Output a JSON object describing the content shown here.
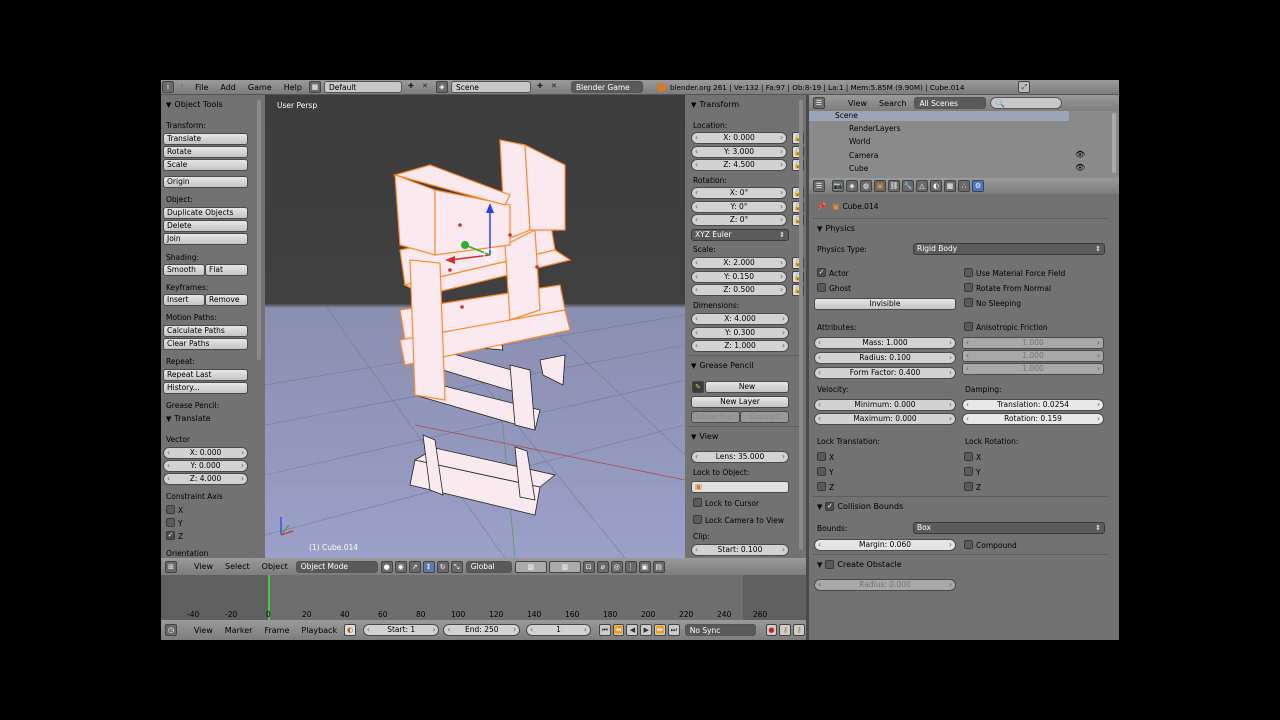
{
  "topbar": {
    "menus": [
      "File",
      "Add",
      "Game",
      "Help"
    ],
    "layout": "Default",
    "scene": "Scene",
    "engine": "Blender Game",
    "stats": "blender.org 261 | Ve:132 | Fa:97 | Ob:8-19 | La:1 | Mem:5.85M (9.90M) | Cube.014"
  },
  "toolshelf": {
    "title": "Object Tools",
    "transform_label": "Transform:",
    "translate": "Translate",
    "rotate": "Rotate",
    "scale": "Scale",
    "origin": "Origin",
    "object_label": "Object:",
    "duplicate": "Duplicate Objects",
    "delete": "Delete",
    "join": "Join",
    "shading_label": "Shading:",
    "smooth": "Smooth",
    "flat": "Flat",
    "keyframes_label": "Keyframes:",
    "insert": "Insert",
    "remove": "Remove",
    "motion_label": "Motion Paths:",
    "calc_paths": "Calculate Paths",
    "clear_paths": "Clear Paths",
    "repeat_label": "Repeat:",
    "repeat_last": "Repeat Last",
    "history": "History...",
    "grease_label": "Grease Pencil:",
    "op_title": "Translate",
    "vector_label": "Vector",
    "vx": "X: 0.000",
    "vy": "Y: 0.000",
    "vz": "Z: 4.000",
    "constraint_label": "Constraint Axis",
    "cx": "X",
    "cy": "Y",
    "cz": "Z",
    "orientation_label": "Orientation"
  },
  "viewport": {
    "title": "User Persp",
    "object": "(1) Cube.014",
    "mode": "Object Mode",
    "orientation": "Global",
    "menus": [
      "View",
      "Select",
      "Object"
    ]
  },
  "npanel": {
    "transform_title": "Transform",
    "location_label": "Location:",
    "lx": "X: 0.000",
    "ly": "Y: 3.000",
    "lz": "Z: 4.500",
    "rotation_label": "Rotation:",
    "rx": "X: 0°",
    "ry": "Y: 0°",
    "rz": "Z: 0°",
    "euler": "XYZ Euler",
    "scale_label": "Scale:",
    "sx": "X: 2.000",
    "sy": "Y: 0.150",
    "sz": "Z: 0.500",
    "dimensions_label": "Dimensions:",
    "dx": "X: 4.000",
    "dy": "Y: 0.300",
    "dz": "Z: 1.000",
    "grease_title": "Grease Pencil",
    "new": "New",
    "new_layer": "New Layer",
    "delete_frame": "Delete Frame",
    "convert": "Convert",
    "view_title": "View",
    "lens": "Lens: 35.000",
    "lock_object": "Lock to Object:",
    "lock_cursor": "Lock to Cursor",
    "lock_camera": "Lock Camera to View",
    "clip_label": "Clip:",
    "clip_start": "Start: 0.100"
  },
  "timeline": {
    "ticks": [
      "-40",
      "-20",
      "0",
      "20",
      "40",
      "60",
      "80",
      "100",
      "120",
      "140",
      "160",
      "180",
      "200",
      "220",
      "240",
      "260"
    ],
    "menus": [
      "View",
      "Marker",
      "Frame",
      "Playback"
    ],
    "start": "Start: 1",
    "end": "End: 250",
    "current": "1",
    "sync": "No Sync"
  },
  "outliner": {
    "menus": [
      "View",
      "Search"
    ],
    "filter": "All Scenes",
    "items": [
      "Scene",
      "RenderLayers",
      "World",
      "Camera",
      "Cube"
    ]
  },
  "props": {
    "breadcrumb": "Cube.014",
    "physics_title": "Physics",
    "physics_type_label": "Physics Type:",
    "physics_type": "Rigid Body",
    "actor": "Actor",
    "ghost": "Ghost",
    "invisible": "Invisible",
    "use_material_friction": "Use Material Force Field",
    "rotate_from_normal": "Rotate From Normal",
    "no_sleeping": "No Sleeping",
    "attributes_label": "Attributes:",
    "mass": "Mass: 1.000",
    "radius": "Radius: 0.100",
    "form_factor": "Form Factor: 0.400",
    "anisotropic": "Anisotropic Friction",
    "aniso_vals": [
      "1.000",
      "1.000",
      "1.000"
    ],
    "velocity_label": "Velocity:",
    "vmin": "Minimum: 0.000",
    "vmax": "Maximum: 0.000",
    "damping_label": "Damping:",
    "dtrans": "Translation: 0.0254",
    "drot": "Rotation: 0.159",
    "lock_translation_label": "Lock Translation:",
    "lock_rotation_label": "Lock Rotation:",
    "axes": [
      "X",
      "Y",
      "Z"
    ],
    "collision_title": "Collision Bounds",
    "bounds_label": "Bounds:",
    "bounds": "Box",
    "margin": "Margin: 0.060",
    "compound": "Compound",
    "obstacle_title": "Create Obstacle",
    "obstacle_radius": "Radius: 0.000"
  },
  "colors": {
    "selected_outline": "#ff8a2a",
    "object_face": "#fbe9f0",
    "active_slider": "#e8e8e8"
  }
}
